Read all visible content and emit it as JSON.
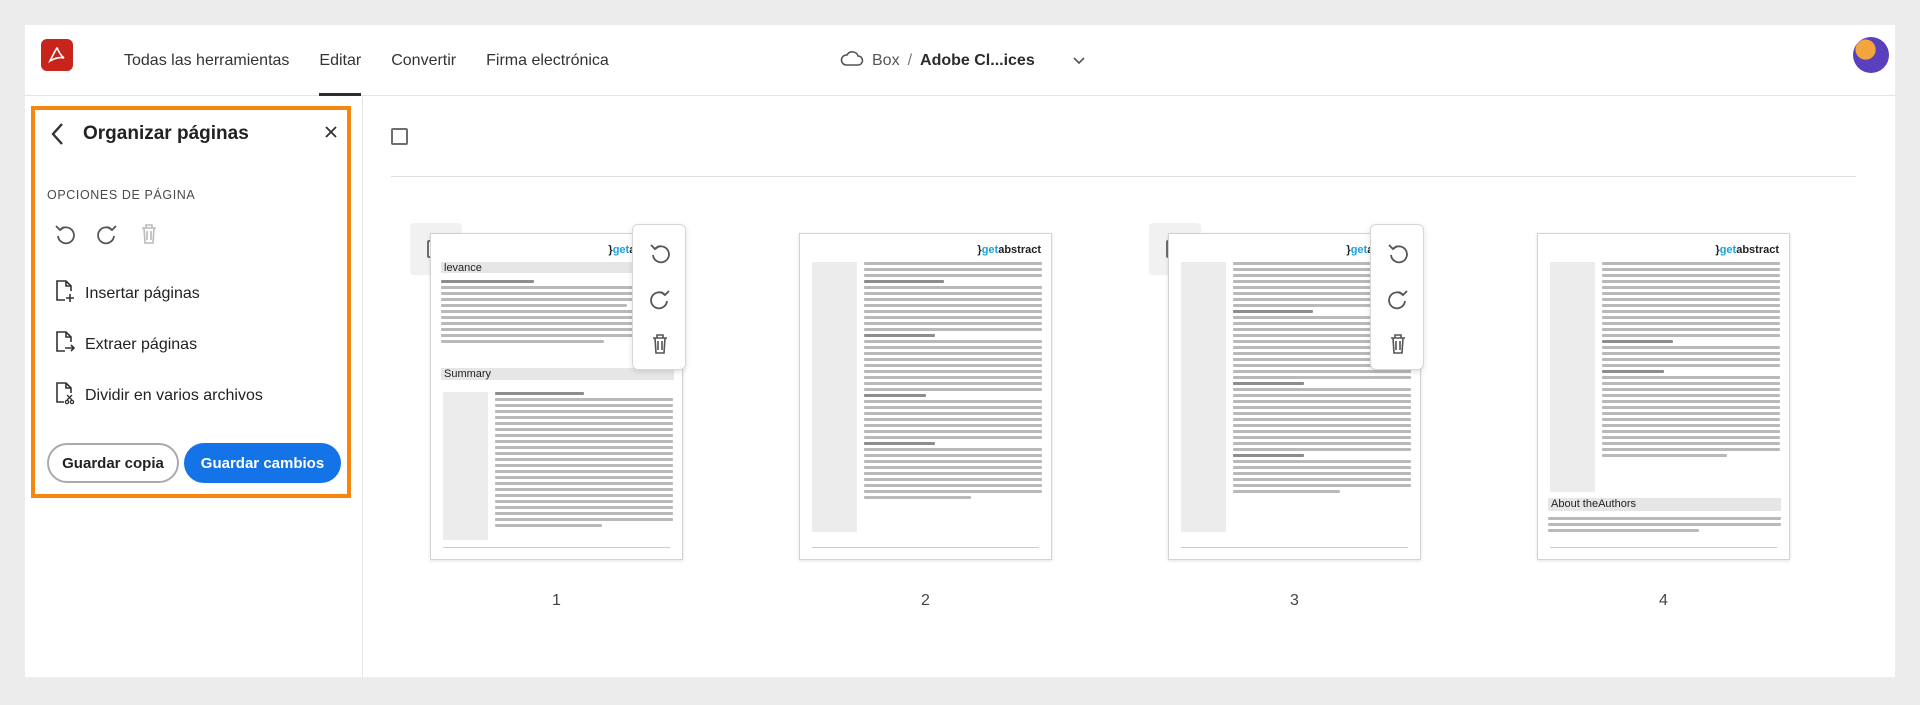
{
  "topbar": {
    "logo_icon": "acrobat-logo-icon",
    "nav": [
      {
        "label": "Todas las herramientas",
        "active": false
      },
      {
        "label": "Editar",
        "active": true
      },
      {
        "label": "Convertir",
        "active": false
      },
      {
        "label": "Firma electrónica",
        "active": false
      }
    ],
    "storage": "Box",
    "separator": "/",
    "doc_name": "Adobe Cl...ices"
  },
  "panel": {
    "title": "Organizar páginas",
    "section_label": "OPCIONES DE PÁGINA",
    "items": [
      {
        "label": "Insertar páginas"
      },
      {
        "label": "Extraer páginas"
      },
      {
        "label": "Dividir en varios archivos"
      }
    ],
    "save_copy": "Guardar copia",
    "save_changes": "Guardar cambios"
  },
  "pages": [
    {
      "number": "1",
      "section_a": "levance",
      "section_b": "Summary",
      "brand": "getabstract",
      "selected_toolbar": true
    },
    {
      "number": "2",
      "brand": "getabstract",
      "selected_toolbar": false
    },
    {
      "number": "3",
      "brand": "getabstract",
      "selected_toolbar": true
    },
    {
      "number": "4",
      "brand": "getabstract",
      "section_a": "About theAuthors",
      "selected_toolbar": false
    }
  ],
  "colors": {
    "accent": "#1473e6",
    "highlight": "#f6860e",
    "logo": "#c7241b"
  }
}
